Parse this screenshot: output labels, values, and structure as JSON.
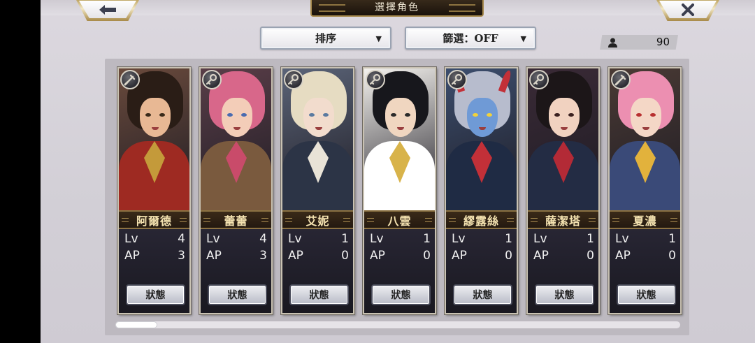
{
  "header": {
    "title": "選擇角色",
    "back_icon": "arrow-left-icon",
    "close_icon": "close-icon"
  },
  "controls": {
    "sort_label": "排序",
    "filter_label": "篩選：OFF",
    "caret_icon": "▼",
    "character_count": "90",
    "count_icon": "user-icon"
  },
  "characters": [
    {
      "name": "阿爾德",
      "lv_label": "Lv",
      "lv": "4",
      "ap_label": "AP",
      "ap": "3",
      "status_label": "狀態",
      "emblem": "sword-icon",
      "colors": {
        "bg": "#6a4a3c",
        "hair": "#2a1d16",
        "skin": "#e8b894",
        "body": "#9e2a22",
        "accent": "#c49a3a",
        "eye": "#3a2a1a"
      }
    },
    {
      "name": "蕾蕾",
      "lv_label": "Lv",
      "lv": "4",
      "ap_label": "AP",
      "ap": "3",
      "status_label": "狀態",
      "emblem": "key-icon",
      "colors": {
        "bg": "#5a3e48",
        "hair": "#d8678a",
        "skin": "#f3cdb8",
        "body": "#7a5a3e",
        "accent": "#c94b6a",
        "eye": "#4a6bb0"
      }
    },
    {
      "name": "艾妮",
      "lv_label": "Lv",
      "lv": "1",
      "ap_label": "AP",
      "ap": "0",
      "status_label": "狀態",
      "emblem": "key-icon",
      "colors": {
        "bg": "#5b6478",
        "hair": "#e6dcc2",
        "skin": "#f2dccd",
        "body": "#2c3446",
        "accent": "#e9e3d7",
        "eye": "#5a7aa0"
      }
    },
    {
      "name": "八雲",
      "lv_label": "Lv",
      "lv": "1",
      "ap_label": "AP",
      "ap": "0",
      "status_label": "狀態",
      "emblem": "key-icon",
      "colors": {
        "bg": "#f4f2ee",
        "hair": "#17171c",
        "skin": "#f0d6c0",
        "body": "#ffffff",
        "accent": "#d8b34a",
        "eye": "#2a2a2a"
      }
    },
    {
      "name": "繆露絲",
      "lv_label": "Lv",
      "lv": "1",
      "ap_label": "AP",
      "ap": "0",
      "status_label": "狀態",
      "emblem": "key-icon",
      "colors": {
        "bg": "#3c4e6e",
        "hair": "#b7bccd",
        "skin": "#6f9ad6",
        "body": "#1f2b44",
        "accent": "#c23038",
        "eye": "#f2d23a"
      }
    },
    {
      "name": "薩潔塔",
      "lv_label": "Lv",
      "lv": "1",
      "ap_label": "AP",
      "ap": "0",
      "status_label": "狀態",
      "emblem": "key-icon",
      "colors": {
        "bg": "#3a2a36",
        "hair": "#1c1618",
        "skin": "#f1d2c0",
        "body": "#232c44",
        "accent": "#b32a36",
        "eye": "#3a2020"
      }
    },
    {
      "name": "夏濃",
      "lv_label": "Lv",
      "lv": "1",
      "ap_label": "AP",
      "ap": "0",
      "status_label": "狀態",
      "emblem": "sword-icon",
      "colors": {
        "bg": "#4a3a34",
        "hair": "#ec8fb1",
        "skin": "#f4d7c6",
        "body": "#3a4a78",
        "accent": "#e2b23c",
        "eye": "#b83030"
      }
    }
  ],
  "scrollbar": {
    "position_fraction": 0.0
  }
}
